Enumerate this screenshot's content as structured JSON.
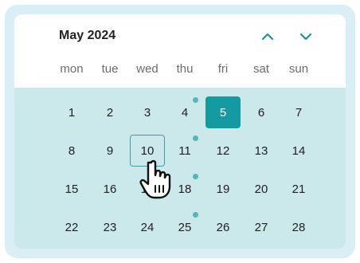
{
  "calendar": {
    "month_label": "May 2024",
    "weekdays": [
      "mon",
      "tue",
      "wed",
      "thu",
      "fri",
      "sat",
      "sun"
    ],
    "weeks": [
      [
        "1",
        "2",
        "3",
        "4",
        "5",
        "6",
        "7"
      ],
      [
        "8",
        "9",
        "10",
        "11",
        "12",
        "13",
        "14"
      ],
      [
        "15",
        "16",
        "17",
        "18",
        "19",
        "20",
        "21"
      ],
      [
        "22",
        "23",
        "24",
        "25",
        "26",
        "27",
        "28"
      ]
    ],
    "selected_day": "5",
    "hovered_day": "10",
    "event_days": [
      "4",
      "11",
      "18",
      "25"
    ],
    "nav": {
      "prev_icon": "chevron-up-icon",
      "next_icon": "chevron-down-icon"
    }
  },
  "colors": {
    "accent": "#169aa1",
    "grid_background": "#cbe8ea",
    "outer_background": "#d9eef5",
    "event_dot": "#55b5b9",
    "chevron": "#1e8f9a"
  },
  "cursor": {
    "icon": "hand-pointer-icon"
  }
}
